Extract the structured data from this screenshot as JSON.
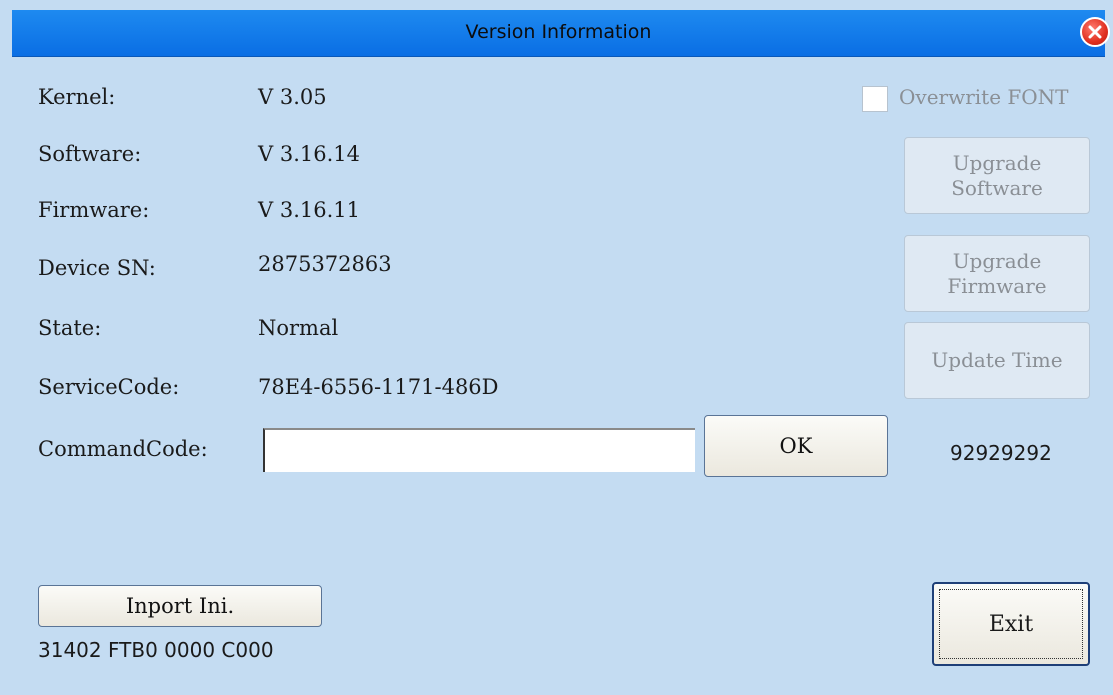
{
  "window": {
    "title": "Version Information"
  },
  "info": {
    "kernel_label": "Kernel:",
    "kernel_value": "V 3.05",
    "software_label": "Software:",
    "software_value": "V 3.16.14",
    "firmware_label": "Firmware:",
    "firmware_value": "V 3.16.11",
    "device_sn_label": "Device SN:",
    "device_sn_value": "2875372863",
    "state_label": "State:",
    "state_value": "Normal",
    "service_code_label": "ServiceCode:",
    "service_code_value": "78E4-6556-1171-486D",
    "command_code_label": "CommandCode:",
    "command_code_value": ""
  },
  "actions": {
    "overwrite_font_label": "Overwrite FONT",
    "overwrite_font_checked": false,
    "upgrade_software_line1": "Upgrade",
    "upgrade_software_line2": "Software",
    "upgrade_firmware_line1": "Upgrade",
    "upgrade_firmware_line2": "Firmware",
    "update_time_label": "Update Time",
    "ok_label": "OK",
    "ok_code_value": "92929292",
    "import_ini_label": "Inport Ini.",
    "footer_code": "31402 FTB0 0000 C000",
    "exit_label": "Exit"
  },
  "colors": {
    "background": "#c4dcf2",
    "titlebar": "#1e8af0",
    "close": "#e0301f"
  },
  "icons": {
    "close": "close-icon"
  }
}
